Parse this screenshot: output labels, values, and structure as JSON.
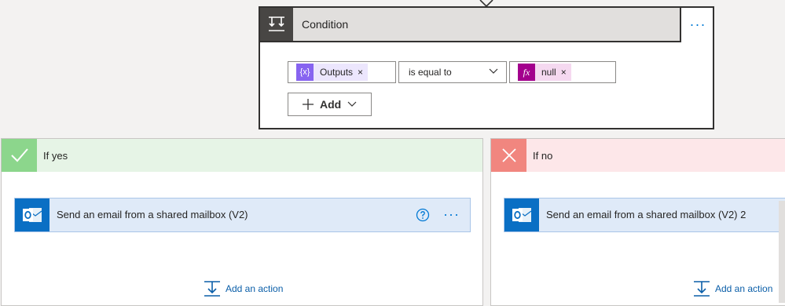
{
  "condition": {
    "title": "Condition",
    "menu": "···",
    "left_token": "Outputs",
    "left_remove": "×",
    "operator": "is equal to",
    "right_token_icon": "fx",
    "right_token": "null",
    "right_remove": "×",
    "add_label": "Add"
  },
  "yes_branch": {
    "title": "If yes",
    "action_title": "Send an email from a shared mailbox (V2)",
    "action_menu": "···",
    "add_action": "Add an action"
  },
  "no_branch": {
    "title": "If no",
    "action_title": "Send an email from a shared mailbox (V2) 2",
    "add_action": "Add an action"
  },
  "colors": {
    "accent": "#0078d4",
    "yes_header": "#8cd68c",
    "no_header": "#f1867f",
    "variable_token": "#8764f0",
    "expression_token": "#a3008d"
  }
}
